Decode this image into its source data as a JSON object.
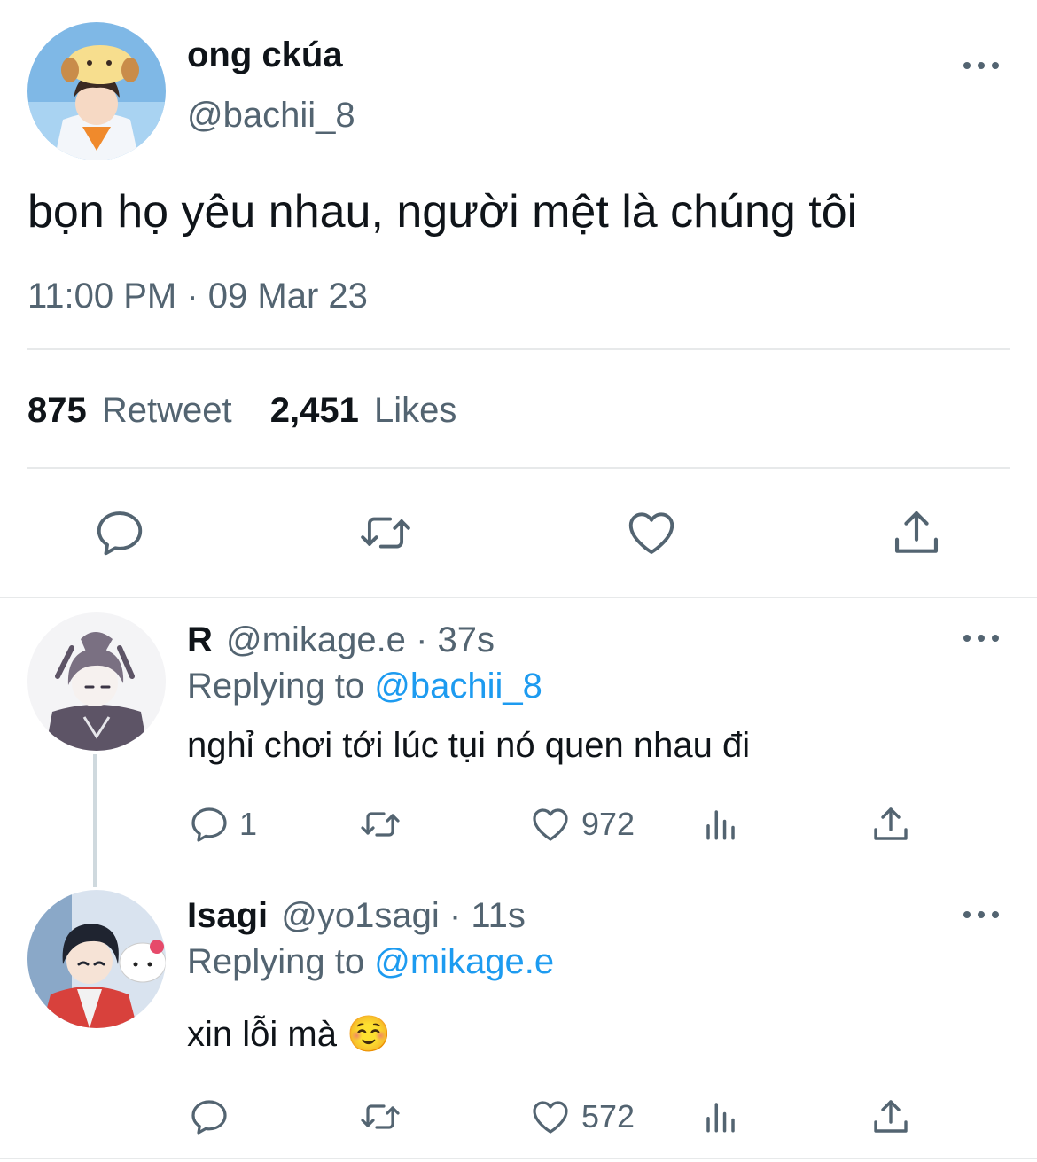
{
  "tweet": {
    "author_name": "ong ckúa",
    "author_handle": "@bachii_8",
    "text": "bọn họ yêu nhau, người mệt là chúng tôi",
    "timestamp": "11:00 PM · 09 Mar 23",
    "retweets_count": "875",
    "retweets_label": "Retweet",
    "likes_count": "2,451",
    "likes_label": "Likes",
    "actions": [
      "reply-icon",
      "retweet-icon",
      "like-icon",
      "share-icon"
    ]
  },
  "replies": [
    {
      "author_name": "R",
      "author_handle": "@mikage.e",
      "time": "· 37s",
      "replying_label": "Replying to",
      "replying_to": "@bachii_8",
      "text": "nghỉ chơi tới lúc tụi nó quen nhau đi",
      "reply_count": "1",
      "like_count": "972"
    },
    {
      "author_name": "Isagi",
      "author_handle": "@yo1sagi",
      "time": "· 11s",
      "replying_label": "Replying to",
      "replying_to": "@mikage.e",
      "text": "xin lỗi mà ☺️",
      "reply_count": "",
      "like_count": "572"
    }
  ],
  "colors": {
    "text": "#0f1419",
    "secondary": "#536471",
    "link": "#1d9bf0",
    "divider": "#e7e9ea"
  }
}
